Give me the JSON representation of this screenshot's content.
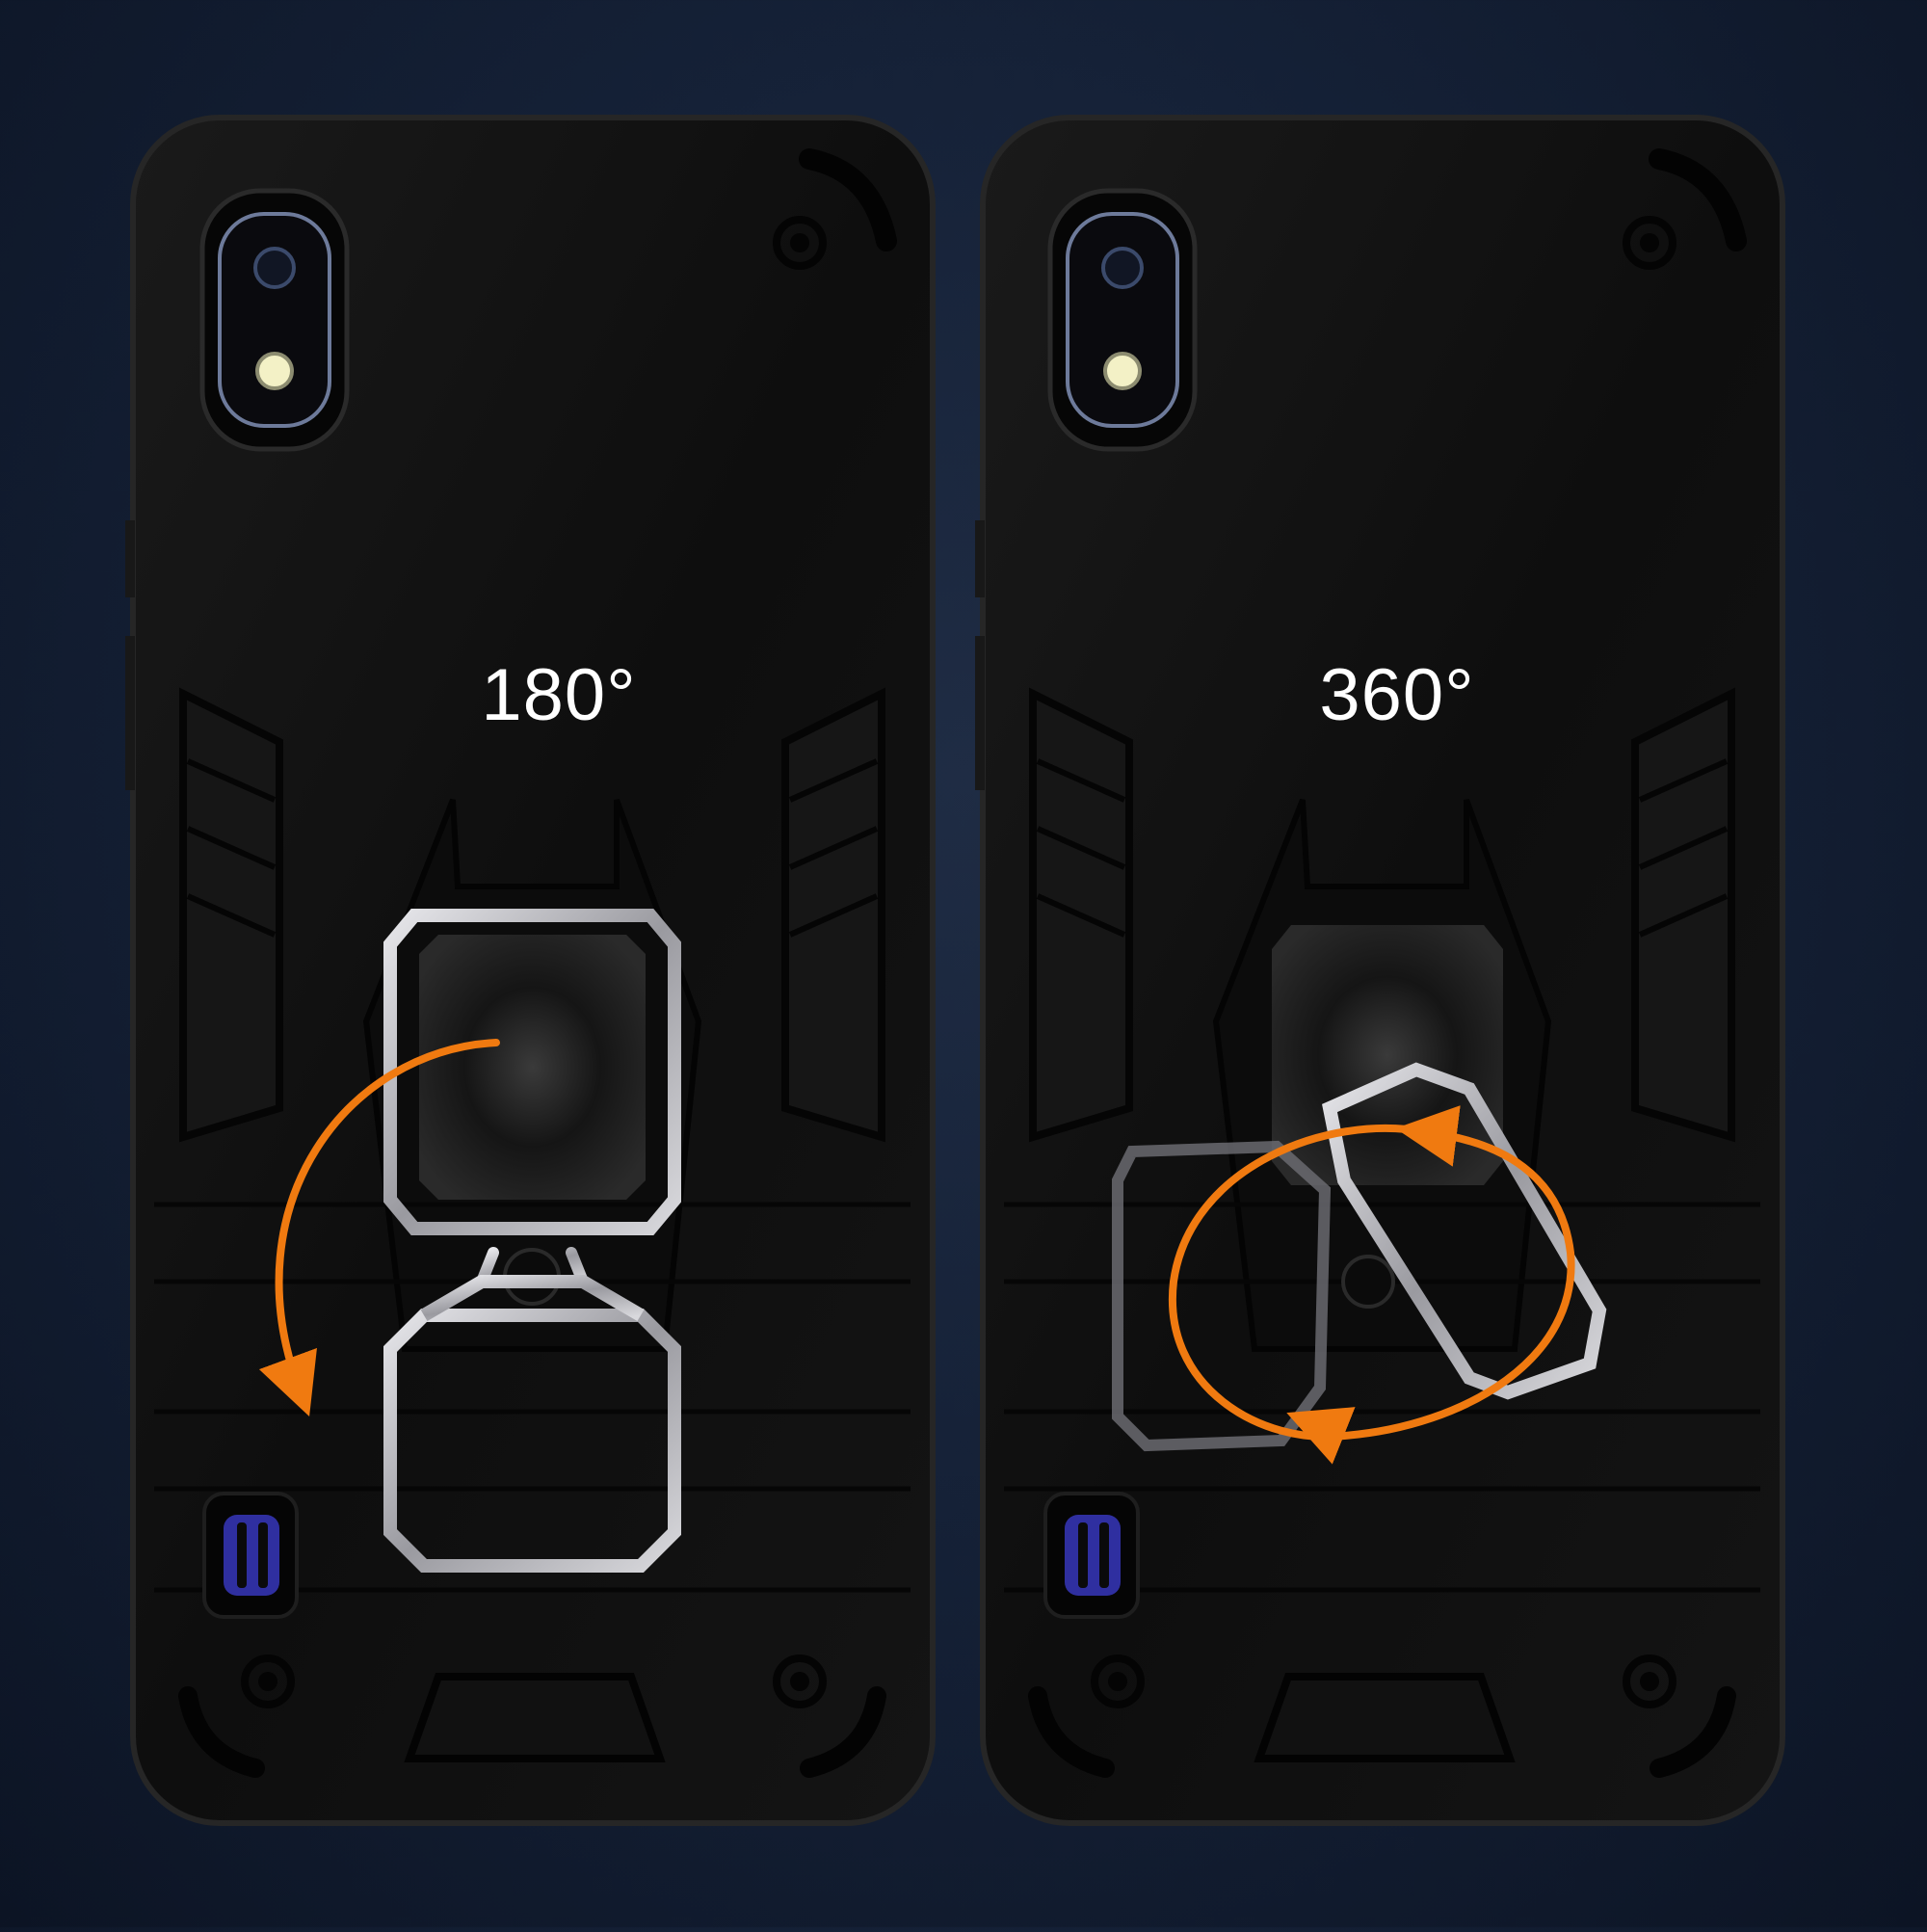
{
  "phones": [
    {
      "id": "left",
      "rotation_label": "180°",
      "ring_state": "flipped-down"
    },
    {
      "id": "right",
      "rotation_label": "360°",
      "ring_state": "spinning"
    }
  ],
  "colors": {
    "background": "#152137",
    "case": "#0d0d0d",
    "ring": "#c8c8cc",
    "arrow": "#f07a10",
    "speaker_accent": "#3a3aa8"
  }
}
